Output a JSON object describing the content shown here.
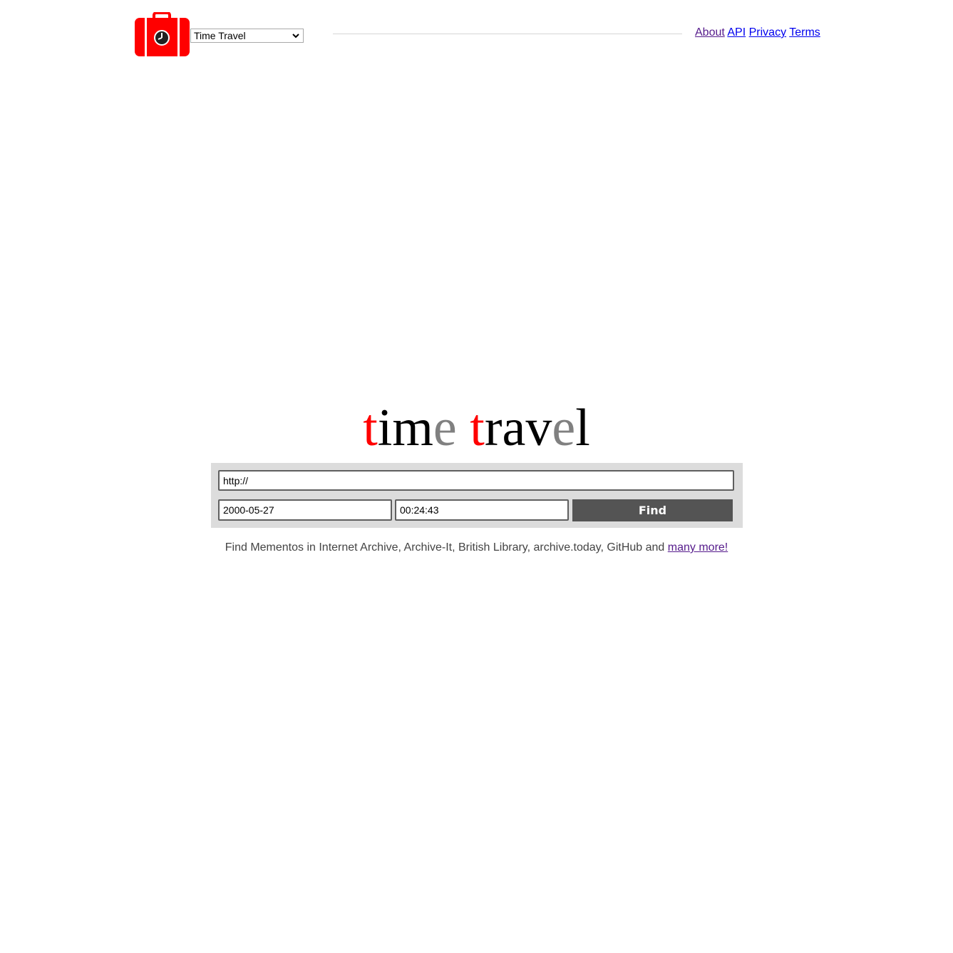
{
  "header": {
    "logo_icon": "suitcase-clock-icon",
    "mode_select": {
      "selected": "Time Travel"
    },
    "nav": [
      {
        "label": "About"
      },
      {
        "label": "API"
      },
      {
        "label": "Privacy"
      },
      {
        "label": "Terms"
      }
    ]
  },
  "title": {
    "parts": [
      "t",
      "im",
      "e",
      " ",
      "t",
      "rav",
      "e",
      "l"
    ]
  },
  "search": {
    "url_value": "http://",
    "date_value": "2000-05-27",
    "time_value": "00:24:43",
    "find_label": "Find"
  },
  "subline": {
    "text": "Find Mementos in Internet Archive, Archive-It, British Library, archive.today, GitHub and ",
    "link_label": "many more!"
  },
  "colors": {
    "brand_red": "#ff0000",
    "gray_letter": "#808080",
    "panel_bg": "#dcdcdc",
    "button_bg": "#545454"
  }
}
